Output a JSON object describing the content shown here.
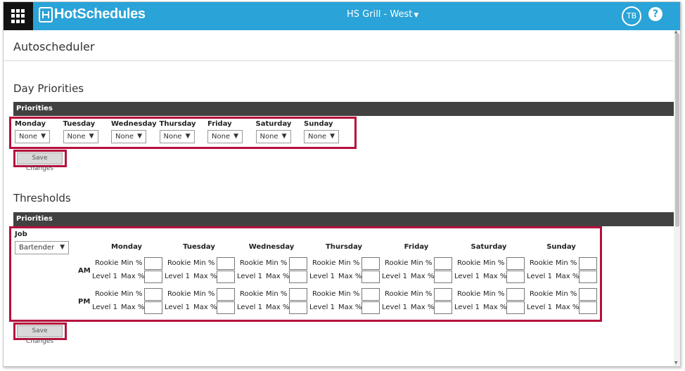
{
  "header": {
    "brand": "HotSchedules",
    "location": "HS Grill - West",
    "avatar_initials": "TB",
    "help_label": "?"
  },
  "page": {
    "title": "Autoscheduler"
  },
  "day_priorities": {
    "title": "Day Priorities",
    "bar_label": "Priorities",
    "days": [
      {
        "label": "Monday",
        "value": "None"
      },
      {
        "label": "Tuesday",
        "value": "None"
      },
      {
        "label": "Wednesday",
        "value": "None"
      },
      {
        "label": "Thursday",
        "value": "None"
      },
      {
        "label": "Friday",
        "value": "None"
      },
      {
        "label": "Saturday",
        "value": "None"
      },
      {
        "label": "Sunday",
        "value": "None"
      }
    ],
    "save_label": "Save Changes"
  },
  "thresholds": {
    "title": "Thresholds",
    "bar_label": "Priorities",
    "job_label": "Job",
    "job_value": "Bartender",
    "days": [
      "Monday",
      "Tuesday",
      "Wednesday",
      "Thursday",
      "Friday",
      "Saturday",
      "Sunday"
    ],
    "periods": [
      "AM",
      "PM"
    ],
    "row1_label": "Rookie",
    "row1_suffix": "Min %",
    "row2_label": "Level 1",
    "row2_suffix": "Max %",
    "save_label": "Save Changes"
  },
  "colors": {
    "topbar": "#2aa3d8",
    "apps_tile": "#121212",
    "section_bar": "#414141",
    "highlight": "#b5103c"
  },
  "icons": [
    "app-grid-icon",
    "hotschedules-logo-icon",
    "chevron-down-icon",
    "help-icon"
  ]
}
